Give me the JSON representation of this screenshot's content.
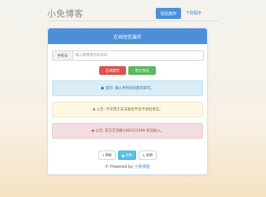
{
  "header": {
    "brand": "小免博客",
    "nav_active_label": "短信轰炸",
    "nav_link_label": "下载程序"
  },
  "panel": {
    "title": "在线短信轰炸",
    "input_label": "手机号",
    "input_placeholder": "输入需要轰炸的号码",
    "start_button": "启动轰炸",
    "stop_button": "停止攻击"
  },
  "alerts": {
    "info_text": "提示: 输入手机号码轰炸即可。",
    "warning_text": "公告: 不可用于非法骚扰平台不承担责任。",
    "danger_text": "公告: 官方交流群1482222908 欢迎加入。"
  },
  "footer": {
    "help_label": "帮助",
    "middle_label": "攻略",
    "thanks_label": "致谢",
    "powered_prefix": "© Powered by",
    "powered_link": "小免博客"
  },
  "colors": {
    "primary": "#4b8fd8",
    "danger": "#d9534f",
    "success": "#5cb85c",
    "info": "#5bc0de"
  }
}
